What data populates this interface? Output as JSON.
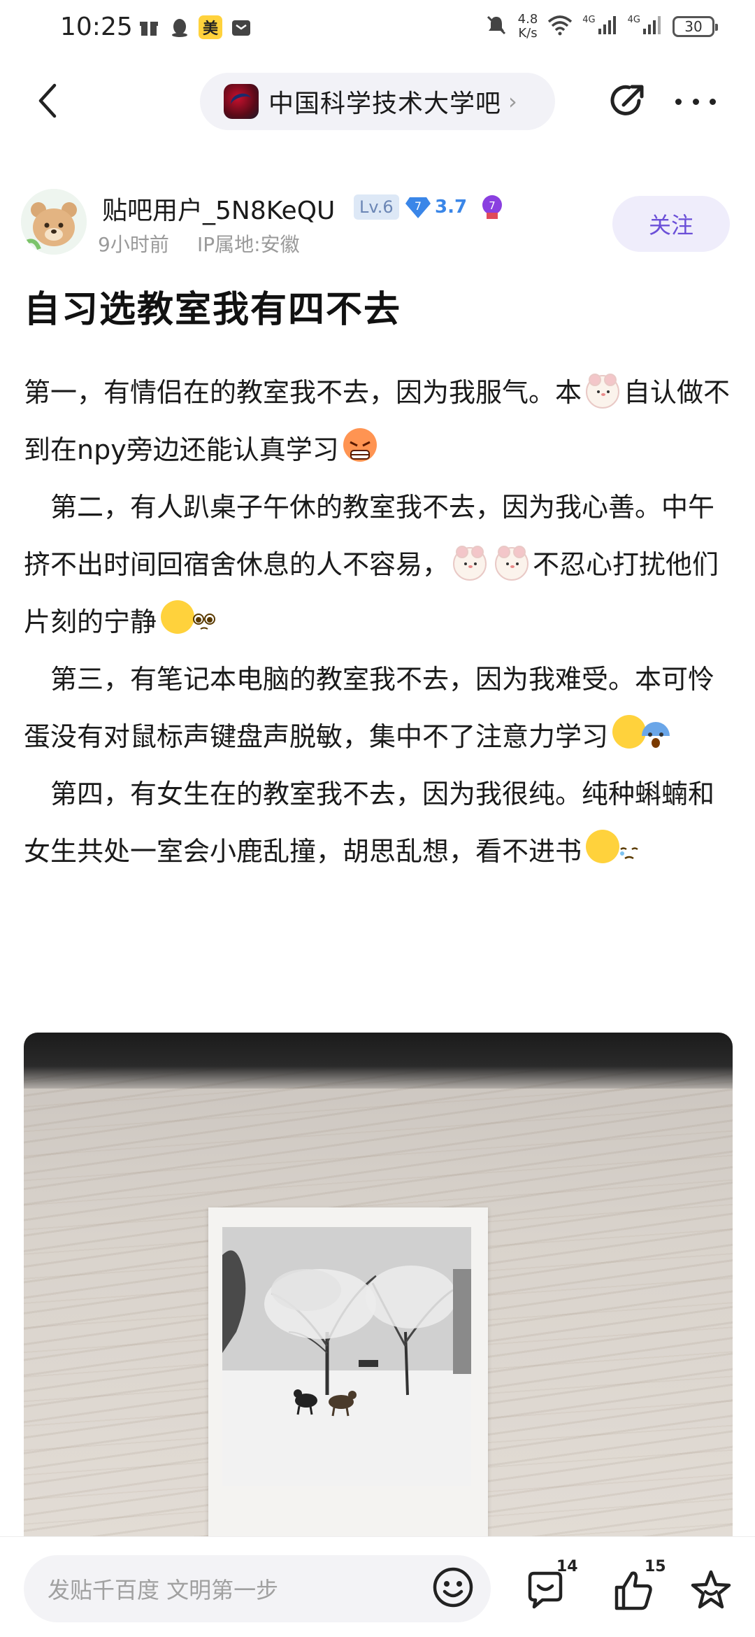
{
  "status_bar": {
    "time": "10:25",
    "mei_badge": "美",
    "speed_value": "4.8",
    "speed_unit": "K/s",
    "net1": "4G",
    "net2": "4G",
    "battery": "30"
  },
  "nav": {
    "forum_name": "中国科学技术大学吧",
    "chevron": "›"
  },
  "author": {
    "name": "贴吧用户_5N8KeQU",
    "level": "Lv.6",
    "gem_level": "7",
    "gem_value": "3.7",
    "medal_level": "7",
    "time": "9小时前",
    "ip": "IP属地:安徽",
    "follow_label": "关注"
  },
  "post": {
    "title": "自习选教室我有四不去",
    "p1a": "第一，有情侣在的教室我不去，因为我服气。本",
    "p1b": "自认做不到在npy旁边还能认真学习",
    "p2a": "第二，有人趴桌子午休的教室我不去，因为我心善。中午挤不出时间回宿舍休息的人不容易，",
    "p2b": "不忍心打扰他们片刻的宁静",
    "p3a": "第三，有笔记本电脑的教室我不去，因为我难受。本可怜蛋没有对鼠标声键盘声脱敏，集中不了注意力学习",
    "p4a": "第四，有女生在的教室我不去，因为我很纯。纯种蝌蝻和女生共处一室会小鹿乱撞，胡思乱想，看不进书"
  },
  "bottom_bar": {
    "reply_placeholder": "发贴千百度 文明第一步",
    "comment_count": "14",
    "like_count": "15"
  },
  "icons": {
    "back": "back-icon",
    "share": "share-icon",
    "more": "more-icon",
    "emoji": "emoji-icon",
    "comment": "comment-icon",
    "like": "thumbs-up-icon",
    "favorite": "star-icon"
  },
  "colors": {
    "accent_purple": "#6b4fd8",
    "follow_bg": "#efedfb",
    "gem_blue": "#3a86e8"
  }
}
